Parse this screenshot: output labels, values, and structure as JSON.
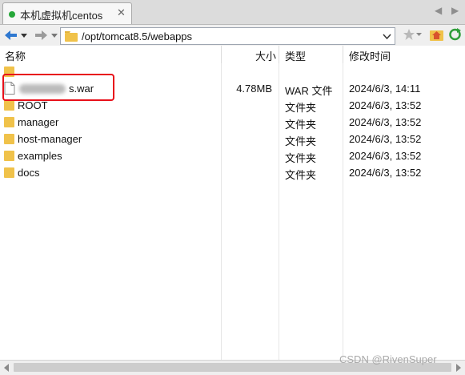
{
  "tab": {
    "title": "本机虚拟机centos",
    "close": "✕"
  },
  "tabnav": {
    "prev": "◀",
    "next": "▶"
  },
  "toolbar": {
    "path": "/opt/tomcat8.5/webapps"
  },
  "columns": {
    "name": "名称",
    "size": "大小",
    "type": "类型",
    "modified": "修改时间"
  },
  "rows": [
    {
      "name": "..",
      "size": "",
      "type": "",
      "date": "",
      "icon": "folder-icon"
    },
    {
      "name": "s.war",
      "size": "4.78MB",
      "type": "WAR 文件",
      "date": "2024/6/3, 14:11",
      "icon": "file-icon"
    },
    {
      "name": "ROOT",
      "size": "",
      "type": "文件夹",
      "date": "2024/6/3, 13:52",
      "icon": "folder-icon"
    },
    {
      "name": "manager",
      "size": "",
      "type": "文件夹",
      "date": "2024/6/3, 13:52",
      "icon": "folder-icon"
    },
    {
      "name": "host-manager",
      "size": "",
      "type": "文件夹",
      "date": "2024/6/3, 13:52",
      "icon": "folder-icon"
    },
    {
      "name": "examples",
      "size": "",
      "type": "文件夹",
      "date": "2024/6/3, 13:52",
      "icon": "folder-icon"
    },
    {
      "name": "docs",
      "size": "",
      "type": "文件夹",
      "date": "2024/6/3, 13:52",
      "icon": "folder-icon"
    }
  ],
  "watermark": "CSDN @RivenSuper",
  "colors": {
    "status_dot": "#26a83a",
    "highlight": "#e8101a",
    "folder": "#f0c24a"
  }
}
